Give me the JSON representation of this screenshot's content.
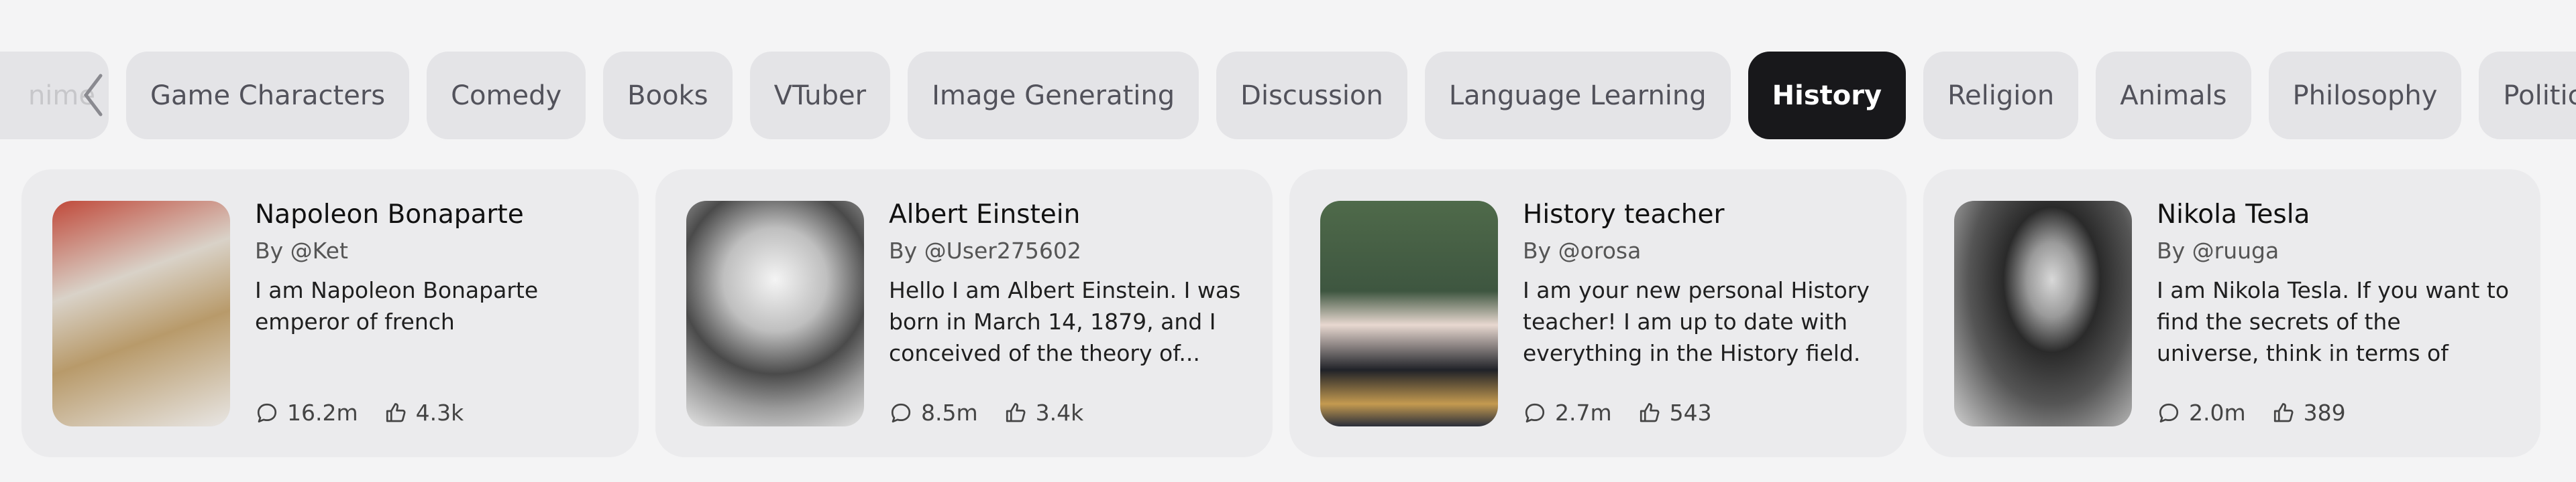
{
  "categories": {
    "partial_label": "nime",
    "items": [
      "Game Characters",
      "Comedy",
      "Books",
      "VTuber",
      "Image Generating",
      "Discussion",
      "Language Learning",
      "History",
      "Religion",
      "Animals",
      "Philosophy",
      "Politics"
    ],
    "active": "History"
  },
  "characters": [
    {
      "name": "Napoleon Bonaparte",
      "author": "By @Ket",
      "description": "I am Napoleon Bonaparte emperor of french",
      "chats": "16.2m",
      "likes": "4.3k"
    },
    {
      "name": "Albert Einstein",
      "author": "By @User275602",
      "description": "Hello I am Albert Einstein. I was born in March 14, 1879, and I conceived of the theory of...",
      "chats": "8.5m",
      "likes": "3.4k"
    },
    {
      "name": "History teacher",
      "author": "By @orosa",
      "description": "I am your new personal History teacher! I am up to date with everything in the History field.",
      "chats": "2.7m",
      "likes": "543"
    },
    {
      "name": "Nikola Tesla",
      "author": "By @ruuga",
      "description": "I am Nikola Tesla. If you want to find the secrets of the universe, think in terms of energy,...",
      "chats": "2.0m",
      "likes": "389"
    }
  ]
}
